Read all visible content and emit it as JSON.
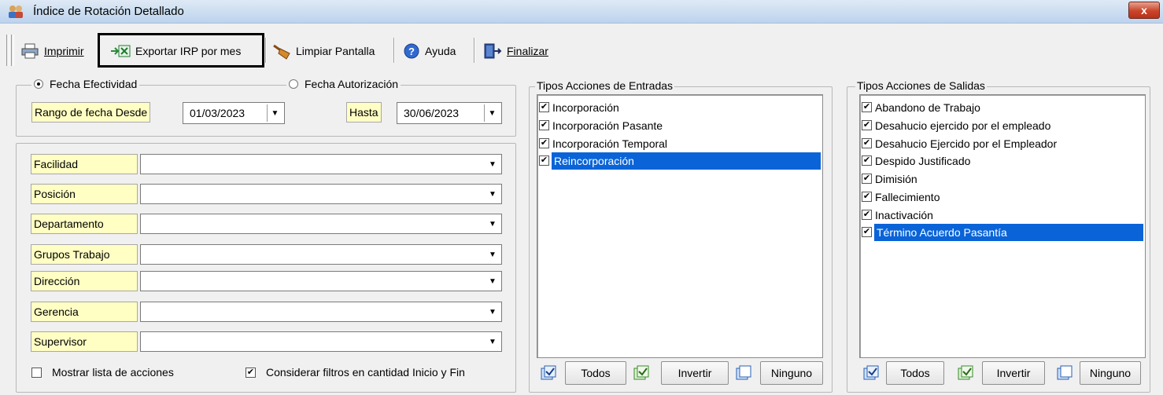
{
  "window": {
    "title": "Índice de Rotación Detallado",
    "close_label": "x"
  },
  "toolbar": {
    "print_label": "Imprimir",
    "export_label": "Exportar IRP por mes",
    "clear_label": "Limpiar Pantalla",
    "help_label": "Ayuda",
    "finish_label": "Finalizar"
  },
  "dates": {
    "radio_effective": "Fecha Efectividad",
    "radio_authorization": "Fecha Autorización",
    "effective_selected": true,
    "from_label": "Rango de fecha Desde",
    "from_value": "01/03/2023",
    "to_label": "Hasta",
    "to_value": "30/06/2023"
  },
  "filters": [
    {
      "label": "Facilidad",
      "value": ""
    },
    {
      "label": "Posición",
      "value": ""
    },
    {
      "label": "Departamento",
      "value": ""
    },
    {
      "label": "Grupos Trabajo",
      "value": ""
    },
    {
      "label": "Dirección",
      "value": ""
    },
    {
      "label": "Gerencia",
      "value": ""
    },
    {
      "label": "Supervisor",
      "value": ""
    }
  ],
  "options": {
    "show_actions_label": "Mostrar lista de acciones",
    "show_actions_checked": false,
    "consider_filters_label": "Considerar filtros en cantidad Inicio y Fin",
    "consider_filters_checked": true
  },
  "entries": {
    "title": "Tipos Acciones de Entradas",
    "items": [
      {
        "label": "Incorporación",
        "checked": true,
        "selected": false
      },
      {
        "label": "Incorporación Pasante",
        "checked": true,
        "selected": false
      },
      {
        "label": "Incorporación Temporal",
        "checked": true,
        "selected": false
      },
      {
        "label": "Reincorporación",
        "checked": true,
        "selected": true
      }
    ],
    "all_label": "Todos",
    "invert_label": "Invertir",
    "none_label": "Ninguno"
  },
  "exits": {
    "title": "Tipos Acciones de Salidas",
    "items": [
      {
        "label": "Abandono de Trabajo",
        "checked": true,
        "selected": false
      },
      {
        "label": "Desahucio ejercido por el empleado",
        "checked": true,
        "selected": false
      },
      {
        "label": "Desahucio Ejercido por el Empleador",
        "checked": true,
        "selected": false
      },
      {
        "label": "Despido Justificado",
        "checked": true,
        "selected": false
      },
      {
        "label": "Dimisión",
        "checked": true,
        "selected": false
      },
      {
        "label": "Fallecimiento",
        "checked": true,
        "selected": false
      },
      {
        "label": "Inactivación",
        "checked": true,
        "selected": false
      },
      {
        "label": "Término Acuerdo Pasantía",
        "checked": true,
        "selected": true
      }
    ],
    "all_label": "Todos",
    "invert_label": "Invertir",
    "none_label": "Ninguno"
  },
  "colors": {
    "selection": "#0a64d8",
    "label_bg": "#ffffc4"
  }
}
